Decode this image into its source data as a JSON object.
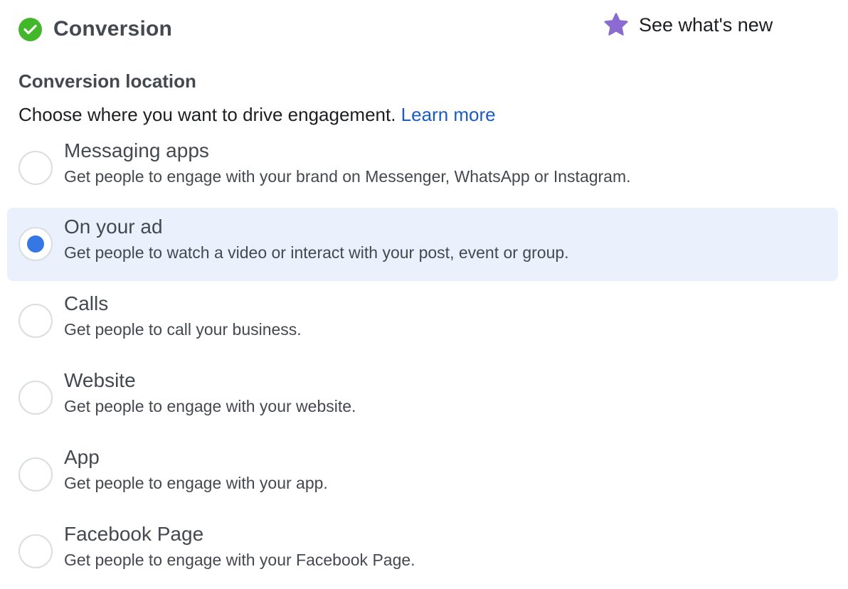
{
  "header": {
    "title": "Conversion",
    "whats_new_label": "See what's new"
  },
  "conversion_location": {
    "heading": "Conversion location",
    "description": "Choose where you want to drive engagement.",
    "learn_more": "Learn more",
    "selected_index": 1,
    "options": [
      {
        "title": "Messaging apps",
        "description": "Get people to engage with your brand on Messenger, WhatsApp or Instagram.",
        "selected": false
      },
      {
        "title": "On your ad",
        "description": "Get people to watch a video or interact with your post, event or group.",
        "selected": true
      },
      {
        "title": "Calls",
        "description": "Get people to call your business.",
        "selected": false
      },
      {
        "title": "Website",
        "description": "Get people to engage with your website.",
        "selected": false
      },
      {
        "title": "App",
        "description": "Get people to engage with your app.",
        "selected": false
      },
      {
        "title": "Facebook Page",
        "description": "Get people to engage with your Facebook Page.",
        "selected": false
      }
    ]
  },
  "icons": {
    "status": "check-circle-icon",
    "whats_new": "star-icon"
  },
  "colors": {
    "check_green": "#42b72a",
    "star_purple": "#8b6bd1",
    "link_blue": "#1a5bc4",
    "radio_selected": "#3578e5",
    "selected_row_bg": "#eaf1fd"
  }
}
